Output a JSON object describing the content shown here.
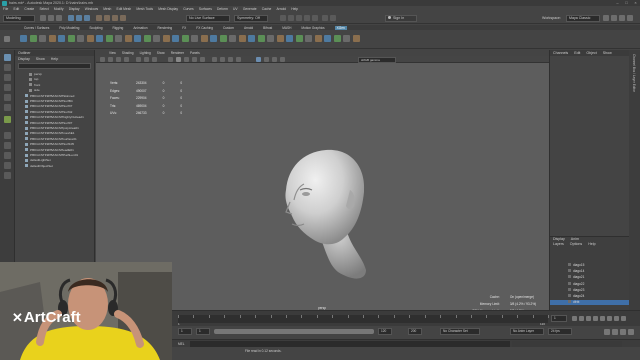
{
  "window": {
    "title": "hairs.mb* - Autodesk Maya 2020.1: D:\\hairs\\hairs.mb"
  },
  "menubar": [
    "File",
    "Edit",
    "Create",
    "Select",
    "Modify",
    "Display",
    "Windows",
    "Mesh",
    "Edit Mesh",
    "Mesh Tools",
    "Mesh Display",
    "Curves",
    "Surfaces",
    "Deform",
    "UV",
    "Generate",
    "Cache",
    "Arnold",
    "Help"
  ],
  "statusline": {
    "mode": "Modeling",
    "live_surface": "No Live Surface",
    "symmetry": "Symmetry: Off",
    "sign_in": "Sign In",
    "workspace_label": "Workspace:",
    "workspace": "Maya Classic"
  },
  "shelf_tabs": [
    "Curves / Surfaces",
    "Poly Modeling",
    "Sculpting",
    "Rigging",
    "Animation",
    "Rendering",
    "FX",
    "FX Caching",
    "Custom",
    "Arnold",
    "Bifrost",
    "MASH",
    "Motion Graphics",
    "XGen"
  ],
  "shelf_active": "XGen",
  "outliner": {
    "title": "Outliner",
    "menu": [
      "Display",
      "Show",
      "Help"
    ],
    "items": [
      "persp",
      "top",
      "front",
      "side",
      "PBKGCSTF9PBASCSHSkinned",
      "PBKGCSTF9PBASCSHSurfB4",
      "PBKGCSTF9PBASCSHSurf37",
      "PBKGCSTF9PBASCSHSurf42",
      "PBKGCSTF9PBASCSHhighlyOutlead1",
      "PBKGCSTF9PBASCSHSurf07",
      "PBKGCSTF9PBASCSHpolyArea01",
      "PBKGCSTF9PBASCSHmeshE1",
      "PBKGCSTF9PBASCSHsurface01",
      "PBKGCSTF9PBASCSHSurf105",
      "PBKGCSTF9PBASCSHeadE01",
      "PBKGCSTF9PBASCSHPathLen01",
      "defaultLightSet",
      "defaultObjectSet"
    ]
  },
  "viewport": {
    "menu": [
      "View",
      "Shading",
      "Lighting",
      "Show",
      "Renderer",
      "Panels"
    ],
    "gamma": "sRGB gamma",
    "hud_stats": [
      [
        "Verts:",
        "243304",
        "0",
        "0"
      ],
      [
        "Edges:",
        "490007",
        "0",
        "0"
      ],
      [
        "Faces:",
        "229904",
        "0",
        "0"
      ],
      [
        "Tris:",
        "469004",
        "0",
        "0"
      ],
      [
        "UVs:",
        "246733",
        "0",
        "0"
      ]
    ],
    "hud_right": [
      [
        "Cache:",
        "On (open/merge)"
      ],
      [
        "Memory Limit:",
        "3/8 (4.2% / 93.2%)"
      ],
      [
        "GPU Memory Limit:",
        "3/8 (4.2%)"
      ]
    ],
    "camera": "persp"
  },
  "right_panel": {
    "tabs": [
      "Channels",
      "Edit",
      "Object",
      "Show"
    ],
    "layer_tabs": [
      "Display",
      "Anim"
    ],
    "layer_menu": [
      "Layers",
      "Options",
      "Help"
    ],
    "layers": [
      "diago15",
      "diago14",
      "diago21",
      "diago22",
      "diago23",
      "diago24",
      "dfrbt"
    ],
    "vertical_label": "Channel Box / Layer Editor"
  },
  "timeline": {
    "start": "1",
    "end": "120",
    "current": "1",
    "range_start": "1",
    "range_end": "120",
    "anim_end": "200",
    "character_set": "No Character Set",
    "anim_layer": "No Anim Layer",
    "fps": "24 fps"
  },
  "cmdline": {
    "label": "MEL"
  },
  "help": {
    "text": "File read in  0.12 seconds."
  },
  "watermark": {
    "text": "ArtCraft"
  },
  "colors": {
    "accent": "#5285a6",
    "selected_layer": "#3f6fa8",
    "bg": "#444444",
    "viewport": "#5d5d5d"
  }
}
